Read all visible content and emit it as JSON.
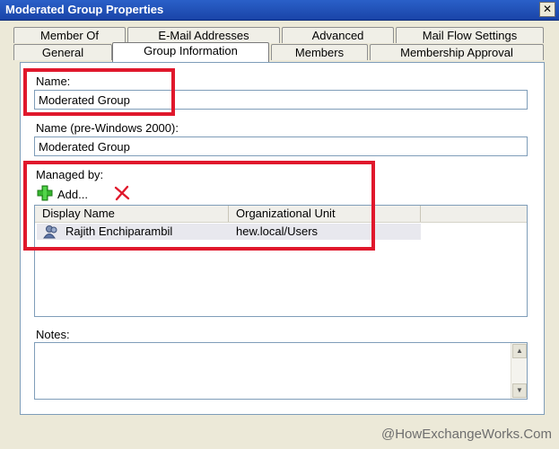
{
  "window": {
    "title": "Moderated Group Properties",
    "close_glyph": "✕"
  },
  "tabs_back": [
    "Member Of",
    "E-Mail Addresses",
    "Advanced",
    "Mail Flow Settings"
  ],
  "tabs_front": [
    "General",
    "Group Information",
    "Members",
    "Membership Approval"
  ],
  "active_tab": "Group Information",
  "fields": {
    "name_label": "Name:",
    "name_value": "Moderated Group",
    "prewin_label": "Name (pre-Windows 2000):",
    "prewin_value": "Moderated Group",
    "managed_label": "Managed by:",
    "add_label": "Add...",
    "notes_label": "Notes:",
    "notes_value": ""
  },
  "managers_table": {
    "columns": [
      "Display Name",
      "Organizational Unit"
    ],
    "rows": [
      {
        "display_name": "Rajith Enchiparambil",
        "ou": "hew.local/Users"
      }
    ]
  },
  "icons": {
    "add": "plus-icon",
    "remove": "red-x-icon",
    "user": "user-icon"
  },
  "accent_colors": {
    "highlight_box": "#e0182c",
    "title_bar": "#1a44a8"
  },
  "watermark": "@HowExchangeWorks.Com"
}
